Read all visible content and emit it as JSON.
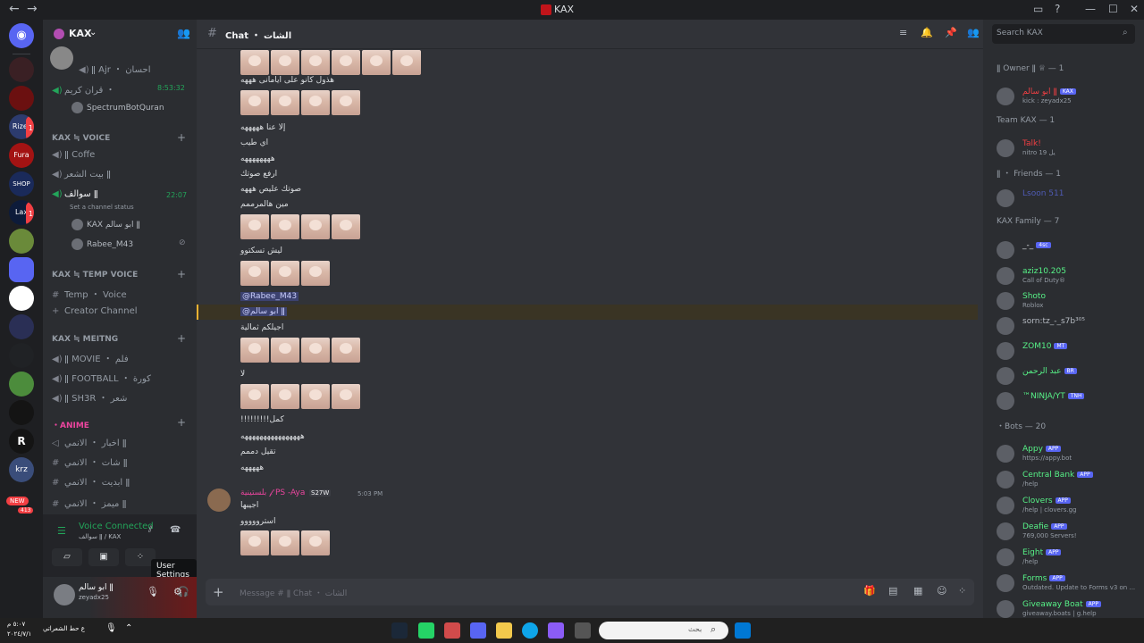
{
  "titlebar": {
    "title": "KAX",
    "back": "←",
    "forward": "→",
    "minimize": "—",
    "maximize": "☐",
    "close": "✕"
  },
  "server": {
    "name": "KAX"
  },
  "sidebar": {
    "top_channels": [
      {
        "label": "ǁ Ajr ・ احسان"
      },
      {
        "label": "قران كريم ・",
        "time": "8:53:32"
      },
      {
        "label": "SpectrumBotQuran"
      }
    ],
    "categories": [
      {
        "label": "KAX ≒ VOICE"
      },
      {
        "label": "KAX ≒ TEMP VOICE"
      },
      {
        "label": "KAX ≒ MEITNG"
      },
      {
        "label": "・ANIME"
      }
    ],
    "voice_channels": [
      {
        "label": "ǁ Coffe"
      },
      {
        "label": "بيت الشعر ǁ"
      },
      {
        "label": "سوالف ǁ",
        "time": "22:07"
      }
    ],
    "channel_status_hint": "Set a channel status",
    "voice_users": [
      "KAX ابو سالم ǁ",
      "Rabee_M43"
    ],
    "temp_channels": [
      {
        "label": "Temp ・ Voice"
      },
      {
        "label": "Creator Channel"
      }
    ],
    "meeting_channels": [
      {
        "label": "ǁ MOVIE ・ فلم"
      },
      {
        "label": "ǁ FOOTBALL ・ كورة"
      },
      {
        "label": "ǁ SH3R ・ شعر"
      }
    ],
    "anime_channels": [
      {
        "label": "اخبار ・ الانمي ǁ"
      },
      {
        "label": "شات ・ الانمي ǁ"
      },
      {
        "label": "ابديت ・ الانمي ǁ"
      },
      {
        "label": "ميمز ・ الانمي ǁ"
      }
    ],
    "voice_status": {
      "title": "Voice Connected",
      "sub": "سوالف ǁ / KAX"
    },
    "user": {
      "name": "ابو سالم ǁ",
      "tag": "zeyadx25"
    },
    "tooltip": "User Settings",
    "new_badge": "NEW",
    "new_count": "413"
  },
  "rail": {
    "servers": [
      {
        "label": "Rizer",
        "badge": "1"
      },
      {
        "label": "Fura",
        "badge": ""
      },
      {
        "label": "SHOP",
        "badge": ""
      },
      {
        "label": "Lax",
        "badge": "1"
      },
      {
        "label": "R",
        "badge": ""
      },
      {
        "label": "krz",
        "badge": ""
      }
    ]
  },
  "chat": {
    "channel": "Chat ・ الشات",
    "search_placeholder": "Search KAX",
    "input_placeholder": "Message # ǁ Chat ・ الشات",
    "lines": [
      "هذول كانو على ايامانى هههه",
      "إلا عنا هههههه",
      "اي طيب",
      "ههههههههه",
      "ارفع صوتك",
      "صوتك عليص هههه",
      "مين هالمرممم",
      "ليش تسكتوو",
      "@Rabee_M43",
      "@ابو سالم ǁ",
      "اجيلكم ثمالية",
      "لا",
      "!!!!!!!!!كمل",
      "ههههههههههههههههه",
      "تقيل دممم",
      "هههههه"
    ],
    "author": {
      "name": "بلستينية 𝒻 PS -Aya",
      "badge": "S27W",
      "time": "5:03 PM"
    },
    "author_lines": [
      "اجيبها",
      "استرووووو"
    ]
  },
  "members": {
    "groups": [
      {
        "title": "ǁ Owner ǁ ♕ — 1",
        "items": [
          {
            "name": "ابو سالم ǁ",
            "tag": "KAX",
            "sub": "kick : zeyadx25",
            "color": "#f23f43"
          }
        ]
      },
      {
        "title": "Team KAX — 1",
        "items": [
          {
            "name": "Talk!",
            "tag": "",
            "sub": "nitro 19 يل",
            "color": "#f23f43"
          }
        ]
      },
      {
        "title": "ǁ ・ Friends — 1",
        "items": [
          {
            "name": "Lsoon 511",
            "tag": "",
            "sub": "",
            "color": "#4f5bb5"
          }
        ]
      },
      {
        "title": "KAX Family — 7",
        "items": [
          {
            "name": "_-_",
            "tag": "4sc",
            "sub": "",
            "color": "#dbdee1"
          },
          {
            "name": "aziz10.205",
            "tag": "",
            "sub": "Call of Duty®",
            "color": "#57f287"
          },
          {
            "name": "Shoto",
            "tag": "",
            "sub": "Roblox",
            "color": "#57f287"
          },
          {
            "name": "sorn:tz_-_s7b³⁰⁵",
            "tag": "",
            "sub": "",
            "color": "#b5bac1"
          },
          {
            "name": "ZOM10",
            "tag": "MT",
            "sub": "",
            "color": "#57f287"
          },
          {
            "name": "عبد الرحمن",
            "tag": "BR",
            "sub": "",
            "color": "#57f287"
          },
          {
            "name": "™NINJA/YT",
            "tag": "TNH",
            "sub": "",
            "color": "#57f287"
          }
        ]
      },
      {
        "title": "・Bots — 20",
        "items": [
          {
            "name": "Appy",
            "tag": "APP",
            "sub": "https://appy.bot",
            "color": "#57f287"
          },
          {
            "name": "Central Bank",
            "tag": "APP",
            "sub": "/help",
            "color": "#57f287"
          },
          {
            "name": "Clovers",
            "tag": "APP",
            "sub": "/help | clovers.gg",
            "color": "#57f287"
          },
          {
            "name": "Deafie",
            "tag": "APP",
            "sub": "769,000 Servers!",
            "color": "#57f287"
          },
          {
            "name": "Eight",
            "tag": "APP",
            "sub": "/help",
            "color": "#57f287"
          },
          {
            "name": "Forms",
            "tag": "APP",
            "sub": "Outdated. Update to Forms v3 on ...",
            "color": "#57f287"
          },
          {
            "name": "Giveaway Boat",
            "tag": "APP",
            "sub": "giveaway.boats | g.help",
            "color": "#57f287"
          }
        ]
      }
    ]
  },
  "taskbar": {
    "search_placeholder": "بحث",
    "clock_time": "٥:٠٧ م",
    "clock_date": "٢٠٢٤/٧/١",
    "weather": "ع حط الشعراتي"
  },
  "colors": {
    "accent": "#5865f2",
    "green": "#23a55a",
    "red": "#f23f43"
  }
}
